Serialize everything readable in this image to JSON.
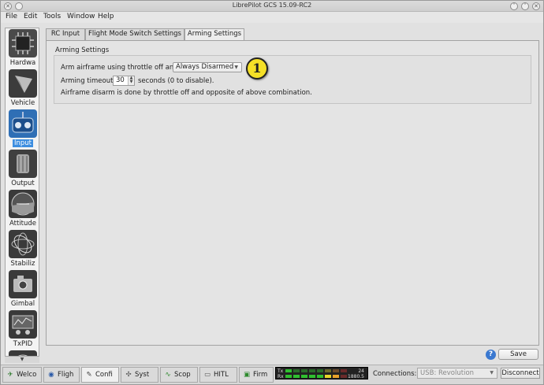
{
  "window": {
    "title": "LibrePilot GCS 15.09-RC2"
  },
  "menu": [
    {
      "label": "File"
    },
    {
      "label": "Edit"
    },
    {
      "label": "Tools"
    },
    {
      "label": "Window"
    },
    {
      "label": "Help"
    }
  ],
  "sidebar": {
    "items": [
      {
        "label": "Hardwa",
        "icon": "hardware-chip-icon"
      },
      {
        "label": "Vehicle",
        "icon": "vehicle-icon"
      },
      {
        "label": "Input",
        "icon": "transmitter-icon",
        "selected": true
      },
      {
        "label": "Output",
        "icon": "motor-icon"
      },
      {
        "label": "Attitude",
        "icon": "attitude-icon"
      },
      {
        "label": "Stabiliz",
        "icon": "stabilization-icon"
      },
      {
        "label": "Gimbal",
        "icon": "camera-icon"
      },
      {
        "label": "TxPID",
        "icon": "txpid-icon"
      }
    ]
  },
  "tabs": [
    {
      "label": "RC Input"
    },
    {
      "label": "Flight Mode Switch Settings"
    },
    {
      "label": "Arming Settings",
      "active": true
    }
  ],
  "arming": {
    "group_title": "Arming Settings",
    "arm_label": "Arm airframe using throttle off and:",
    "arm_value": "Always Disarmed",
    "timeout_label": "Arming timeout:",
    "timeout_value": "30",
    "timeout_suffix": "seconds (0 to disable).",
    "disarm_note": "Airframe disarm is done by throttle off and opposite of above combination."
  },
  "annotation": {
    "label": "1"
  },
  "actions": {
    "help_label": "?",
    "save_label": "Save"
  },
  "bottom_tabs": [
    {
      "label": "Welco",
      "icon": "welcome-icon"
    },
    {
      "label": "Fligh",
      "icon": "flight-icon"
    },
    {
      "label": "Confi",
      "icon": "wrench-icon",
      "active": true
    },
    {
      "label": "Syst",
      "icon": "system-icon"
    },
    {
      "label": "Scop",
      "icon": "scope-icon"
    },
    {
      "label": "HITL",
      "icon": "hitl-icon"
    },
    {
      "label": "Firm",
      "icon": "firmware-icon"
    }
  ],
  "telemetry": {
    "tx_label": "Tx",
    "rx_label": "Rx",
    "tx_value": "24",
    "rx_value": "1880.5"
  },
  "connection": {
    "label": "Connections:",
    "value": "USB: Revolution",
    "disconnect_label": "Disconnect"
  },
  "colors": {
    "accent": "#3d8ee0",
    "badge": "#f5e027"
  }
}
